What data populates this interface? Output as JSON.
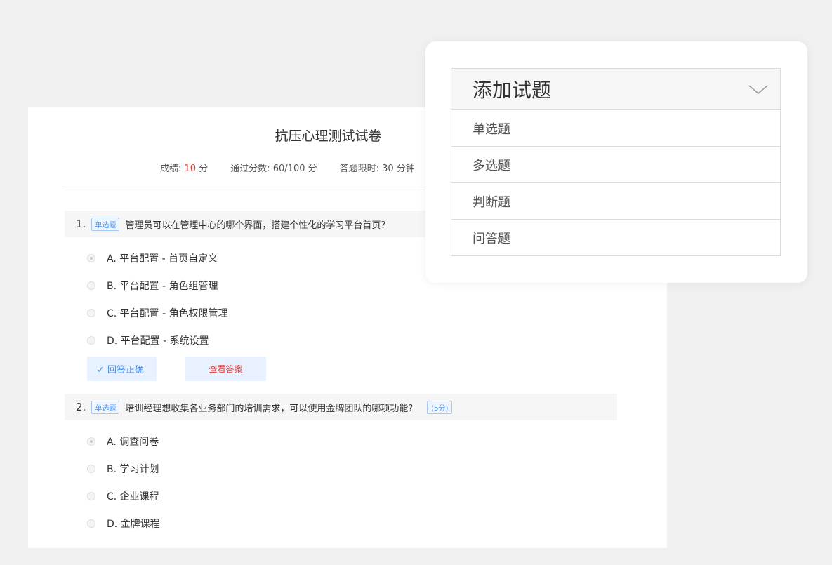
{
  "exam": {
    "title": "抗压心理测试试卷",
    "score_label": "成绩:",
    "score_value": "10",
    "score_unit": "分",
    "pass_label": "通过分数: 60/100 分",
    "time_label": "答题限时: 30 分钟"
  },
  "questions": [
    {
      "number": "1.",
      "tag": "单选题",
      "text": "管理员可以在管理中心的哪个界面，搭建个性化的学习平台首页?",
      "options": [
        {
          "label": "A. 平台配置 - 首页自定义",
          "checked": true
        },
        {
          "label": "B. 平台配置 - 角色组管理",
          "checked": false
        },
        {
          "label": "C. 平台配置 - 角色权限管理",
          "checked": false
        },
        {
          "label": "D. 平台配置 - 系统设置",
          "checked": false
        }
      ],
      "result_label": "✓ 回答正确",
      "answer_button": "查看答案"
    },
    {
      "number": "2.",
      "tag": "单选题",
      "text": "培训经理想收集各业务部门的培训需求，可以使用金牌团队的哪项功能?",
      "score": "(5分)",
      "options": [
        {
          "label": "A. 调查问卷",
          "checked": true
        },
        {
          "label": "B. 学习计划",
          "checked": false
        },
        {
          "label": "C. 企业课程",
          "checked": false
        },
        {
          "label": "D. 金牌课程",
          "checked": false
        }
      ]
    }
  ],
  "dropdown": {
    "title": "添加试题",
    "icon": "chevron-down-icon",
    "items": [
      "单选题",
      "多选题",
      "判断题",
      "问答题"
    ]
  },
  "colors": {
    "accent_blue": "#4a8fe7",
    "accent_red": "#e53935"
  }
}
